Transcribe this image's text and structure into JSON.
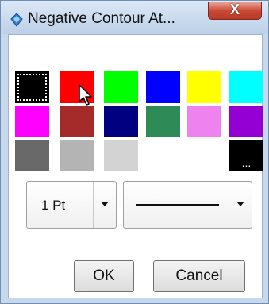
{
  "window": {
    "title": "Negative Contour At...",
    "close_label": "X"
  },
  "palette": {
    "rows": [
      [
        "#000000",
        "#ff0000",
        "#00ff00",
        "#0000ff",
        "#ffff00",
        "#00ffff"
      ],
      [
        "#ff00ff",
        "#a52a2a",
        "#000080",
        "#2e8b57",
        "#ee82ee",
        "#9400d3"
      ],
      [
        "#696969",
        "#b4b4b4",
        "#d3d3d3",
        "#ffffff",
        null,
        "#000000"
      ]
    ],
    "selected": "#000000",
    "more_label": "..."
  },
  "line_width": {
    "value": "1 Pt"
  },
  "line_style": {
    "value": "solid"
  },
  "buttons": {
    "ok": "OK",
    "cancel": "Cancel"
  }
}
